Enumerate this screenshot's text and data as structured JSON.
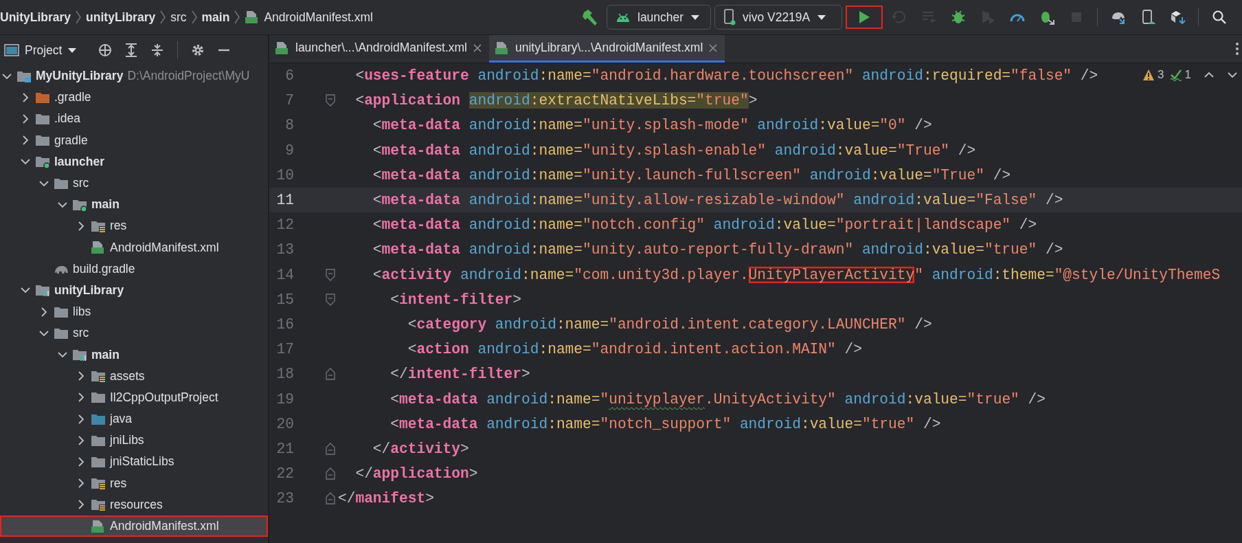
{
  "breadcrumbs": [
    {
      "label": "UnityLibrary",
      "bold": true,
      "kind": "folder"
    },
    {
      "label": "unityLibrary",
      "bold": true,
      "kind": "folder"
    },
    {
      "label": "src",
      "bold": false,
      "kind": "folder"
    },
    {
      "label": "main",
      "bold": true,
      "kind": "folder"
    },
    {
      "label": "AndroidManifest.xml",
      "bold": false,
      "kind": "manifest"
    }
  ],
  "run_configuration": {
    "label": "launcher"
  },
  "device": {
    "label": "vivo V2219A",
    "connected": true
  },
  "run_button": {
    "boxed": true
  },
  "toolbar_actions": [
    {
      "kind": "rerun",
      "disabled": true
    },
    {
      "kind": "apply",
      "disabled": true
    },
    {
      "kind": "debug",
      "disabled": false
    },
    {
      "kind": "coverage",
      "disabled": true
    },
    {
      "kind": "profile",
      "disabled": false
    },
    {
      "kind": "attach",
      "disabled": false
    },
    {
      "kind": "stop",
      "disabled": true
    },
    {
      "kind": "sync",
      "disabled": false
    },
    {
      "kind": "devices",
      "disabled": false
    },
    {
      "kind": "sdk",
      "disabled": false
    },
    {
      "kind": "search",
      "disabled": false
    }
  ],
  "project_panel": {
    "title": "Project"
  },
  "tree": [
    {
      "label": "MyUnityLibrary",
      "detail": "D:\\AndroidProject\\MyU",
      "bold": true,
      "kind": "project",
      "expanded": true,
      "selected": false,
      "boxed": false,
      "children": [
        {
          "label": ".gradle",
          "bold": false,
          "kind": "excluded",
          "expanded": false,
          "selected": false,
          "boxed": false
        },
        {
          "label": ".idea",
          "bold": false,
          "kind": "folder",
          "expanded": false,
          "selected": false,
          "boxed": false
        },
        {
          "label": "gradle",
          "bold": false,
          "kind": "folder",
          "expanded": false,
          "selected": false,
          "boxed": false
        },
        {
          "label": "launcher",
          "bold": true,
          "kind": "app",
          "expanded": true,
          "selected": false,
          "boxed": false,
          "children": [
            {
              "label": "src",
              "bold": false,
              "kind": "folder",
              "expanded": true,
              "selected": false,
              "boxed": false,
              "children": [
                {
                  "label": "main",
                  "bold": true,
                  "kind": "app",
                  "expanded": true,
                  "selected": false,
                  "boxed": false,
                  "children": [
                    {
                      "label": "res",
                      "bold": false,
                      "kind": "res",
                      "expanded": false,
                      "selected": false,
                      "boxed": false
                    },
                    {
                      "label": "AndroidManifest.xml",
                      "bold": false,
                      "kind": "manifest",
                      "selected": false,
                      "boxed": false
                    }
                  ]
                }
              ]
            },
            {
              "label": "build.gradle",
              "bold": false,
              "kind": "gradle",
              "selected": false,
              "boxed": false
            }
          ]
        },
        {
          "label": "unityLibrary",
          "bold": true,
          "kind": "library",
          "expanded": true,
          "selected": false,
          "boxed": false,
          "children": [
            {
              "label": "libs",
              "bold": false,
              "kind": "folder",
              "expanded": false,
              "selected": false,
              "boxed": false
            },
            {
              "label": "src",
              "bold": false,
              "kind": "folder",
              "expanded": true,
              "selected": false,
              "boxed": false,
              "children": [
                {
                  "label": "main",
                  "bold": true,
                  "kind": "library",
                  "expanded": true,
                  "selected": false,
                  "boxed": false,
                  "children": [
                    {
                      "label": "assets",
                      "bold": false,
                      "kind": "res",
                      "expanded": false,
                      "selected": false,
                      "boxed": false
                    },
                    {
                      "label": "Il2CppOutputProject",
                      "bold": false,
                      "kind": "folder",
                      "expanded": false,
                      "selected": false,
                      "boxed": false
                    },
                    {
                      "label": "java",
                      "bold": false,
                      "kind": "source",
                      "expanded": false,
                      "selected": false,
                      "boxed": false
                    },
                    {
                      "label": "jniLibs",
                      "bold": false,
                      "kind": "folder",
                      "expanded": false,
                      "selected": false,
                      "boxed": false
                    },
                    {
                      "label": "jniStaticLibs",
                      "bold": false,
                      "kind": "folder",
                      "expanded": false,
                      "selected": false,
                      "boxed": false
                    },
                    {
                      "label": "res",
                      "bold": false,
                      "kind": "res",
                      "expanded": false,
                      "selected": false,
                      "boxed": false
                    },
                    {
                      "label": "resources",
                      "bold": false,
                      "kind": "res",
                      "expanded": false,
                      "selected": false,
                      "boxed": false
                    },
                    {
                      "label": "AndroidManifest.xml",
                      "bold": false,
                      "kind": "manifest",
                      "selected": true,
                      "boxed": true
                    }
                  ]
                }
              ]
            }
          ]
        }
      ]
    }
  ],
  "tabs": [
    {
      "label": "launcher\\...\\AndroidManifest.xml",
      "selected": false
    },
    {
      "label": "unityLibrary\\...\\AndroidManifest.xml",
      "selected": true
    }
  ],
  "inspections": {
    "warnings": "3",
    "weak_warnings": "1"
  },
  "code_lines": [
    {
      "number": "6",
      "current": false,
      "kind": "plain",
      "parts": [
        {
          "text": "  <uses-feature android:name=\"android.hardware.touchscreen\" android:required=\"false\" />"
        }
      ]
    },
    {
      "number": "7",
      "current": false,
      "kind": "fold-start",
      "parts": [
        {
          "text": "  <application "
        },
        {
          "text": "android:extractNativeLibs=\"true\"",
          "highlighted": true
        },
        {
          "text": ">"
        }
      ]
    },
    {
      "number": "8",
      "current": false,
      "kind": "plain",
      "parts": [
        {
          "text": "    <meta-data android:name=\"unity.splash-mode\" android:value=\"0\" />"
        }
      ]
    },
    {
      "number": "9",
      "current": false,
      "kind": "plain",
      "parts": [
        {
          "text": "    <meta-data android:name=\"unity.splash-enable\" android:value=\"True\" />"
        }
      ]
    },
    {
      "number": "10",
      "current": false,
      "kind": "plain",
      "parts": [
        {
          "text": "    <meta-data android:name=\"unity.launch-fullscreen\" android:value=\"True\" />"
        }
      ]
    },
    {
      "number": "11",
      "current": true,
      "kind": "plain",
      "parts": [
        {
          "text": "    <meta-data android:name=\"unity.allow-resizable-window\" android:value=\"False\" />"
        }
      ]
    },
    {
      "number": "12",
      "current": false,
      "kind": "plain",
      "parts": [
        {
          "text": "    <meta-data android:name=\"notch.config\" android:value=\"portrait|landscape\" />"
        }
      ]
    },
    {
      "number": "13",
      "current": false,
      "kind": "plain",
      "parts": [
        {
          "text": "    <meta-data android:name=\"unity.auto-report-fully-drawn\" android:value=\"true\" />"
        }
      ]
    },
    {
      "number": "14",
      "current": false,
      "kind": "fold-start",
      "parts": [
        {
          "text": "    <activity android:name=\"com.unity3d.player."
        },
        {
          "text": "UnityPlayerActivity",
          "boxed": true
        },
        {
          "text": "\" android:theme=\"@style/UnityThemeS"
        }
      ]
    },
    {
      "number": "15",
      "current": false,
      "kind": "fold-start",
      "parts": [
        {
          "text": "      <intent-filter>"
        }
      ]
    },
    {
      "number": "16",
      "current": false,
      "kind": "plain",
      "parts": [
        {
          "text": "        <category android:name=\"android.intent.category.LAUNCHER\" />"
        }
      ]
    },
    {
      "number": "17",
      "current": false,
      "kind": "plain",
      "parts": [
        {
          "text": "        <action android:name=\"android.intent.action.MAIN\" />"
        }
      ]
    },
    {
      "number": "18",
      "current": false,
      "kind": "fold-end",
      "parts": [
        {
          "text": "      </intent-filter>"
        }
      ]
    },
    {
      "number": "19",
      "current": false,
      "kind": "plain",
      "parts": [
        {
          "text": "      <meta-data android:name=\""
        },
        {
          "text": "unityplayer",
          "typo": true
        },
        {
          "text": ".UnityActivity\" android:value=\"true\" />"
        }
      ]
    },
    {
      "number": "20",
      "current": false,
      "kind": "plain",
      "parts": [
        {
          "text": "      <meta-data android:name=\"notch_support\" android:value=\"true\" />"
        }
      ]
    },
    {
      "number": "21",
      "current": false,
      "kind": "fold-end",
      "parts": [
        {
          "text": "    </activity>"
        }
      ]
    },
    {
      "number": "22",
      "current": false,
      "kind": "fold-end",
      "parts": [
        {
          "text": "  </application>"
        }
      ]
    },
    {
      "number": "23",
      "current": false,
      "kind": "fold-end",
      "parts": [
        {
          "text": "</manifest>"
        }
      ]
    }
  ]
}
